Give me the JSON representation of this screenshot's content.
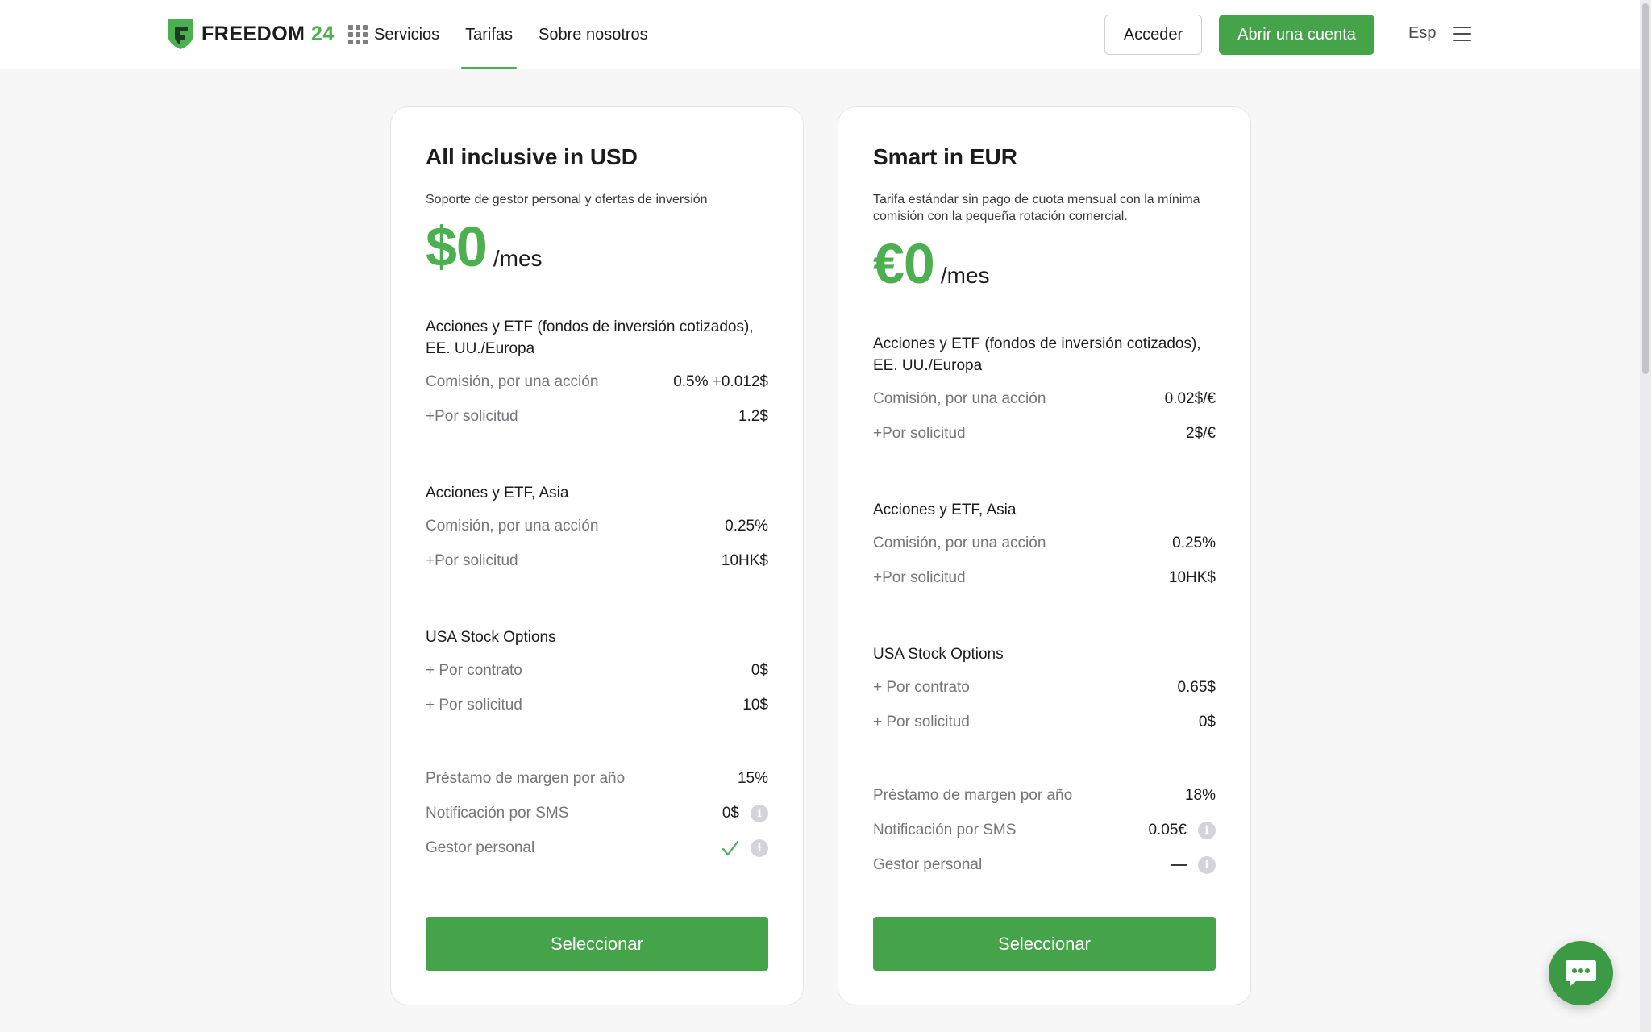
{
  "header": {
    "brand": {
      "word": "FREEDOM",
      "number": "24"
    },
    "nav": [
      {
        "label": "Servicios",
        "icon": "grid-icon",
        "active": false
      },
      {
        "label": "Tarifas",
        "active": true
      },
      {
        "label": "Sobre nosotros",
        "active": false
      }
    ],
    "login_label": "Acceder",
    "open_account_label": "Abrir una cuenta",
    "language": "Esp"
  },
  "colors": {
    "accent": "#4caf50",
    "button": "#45a34a"
  },
  "plans": [
    {
      "name": "All inclusive in USD",
      "description": "Soporte de gestor personal y ofertas de inversión",
      "price": "$0",
      "period": "/mes",
      "sections": [
        {
          "title": "Acciones y ETF (fondos de inversión cotizados), EE. UU./Europa",
          "rows": [
            {
              "label": "Comisión, por una acción",
              "value": "0.5% +0.012$"
            },
            {
              "label": "+Por solicitud",
              "value": "1.2$"
            }
          ]
        },
        {
          "title": "Acciones y ETF, Asia",
          "rows": [
            {
              "label": "Comisión, por una acción",
              "value": "0.25%"
            },
            {
              "label": "+Por solicitud",
              "value": "10HK$"
            }
          ]
        },
        {
          "title": "USA Stock Options",
          "rows": [
            {
              "label": "+ Por contrato",
              "value": "0$"
            },
            {
              "label": "+ Por solicitud",
              "value": "10$"
            }
          ]
        }
      ],
      "extras": [
        {
          "label": "Préstamo de margen por año",
          "value": "15%"
        },
        {
          "label": "Notificación por SMS",
          "value": "0$",
          "info": true
        },
        {
          "label": "Gestor personal",
          "value": "",
          "icon": "check-icon",
          "info": true
        }
      ],
      "select_label": "Seleccionar"
    },
    {
      "name": "Smart in EUR",
      "description": "Tarifa estándar sin pago de cuota mensual con la mínima comisión con la pequeña rotación comercial.",
      "price": "€0",
      "period": "/mes",
      "sections": [
        {
          "title": "Acciones y ETF (fondos de inversión cotizados), EE. UU./Europa",
          "rows": [
            {
              "label": "Comisión, por una acción",
              "value": "0.02$/€"
            },
            {
              "label": "+Por solicitud",
              "value": "2$/€"
            }
          ]
        },
        {
          "title": "Acciones y ETF, Asia",
          "rows": [
            {
              "label": "Comisión, por una acción",
              "value": "0.25%"
            },
            {
              "label": "+Por solicitud",
              "value": "10HK$"
            }
          ]
        },
        {
          "title": "USA Stock Options",
          "rows": [
            {
              "label": "+ Por contrato",
              "value": "0.65$"
            },
            {
              "label": "+ Por solicitud",
              "value": "0$"
            }
          ]
        }
      ],
      "extras": [
        {
          "label": "Préstamo de margen por año",
          "value": "18%"
        },
        {
          "label": "Notificación por SMS",
          "value": "0.05€",
          "info": true
        },
        {
          "label": "Gestor personal",
          "value": "",
          "icon": "dash-icon",
          "info": true
        }
      ],
      "select_label": "Seleccionar"
    }
  ],
  "chat": {
    "icon": "chat-bubble-icon"
  }
}
